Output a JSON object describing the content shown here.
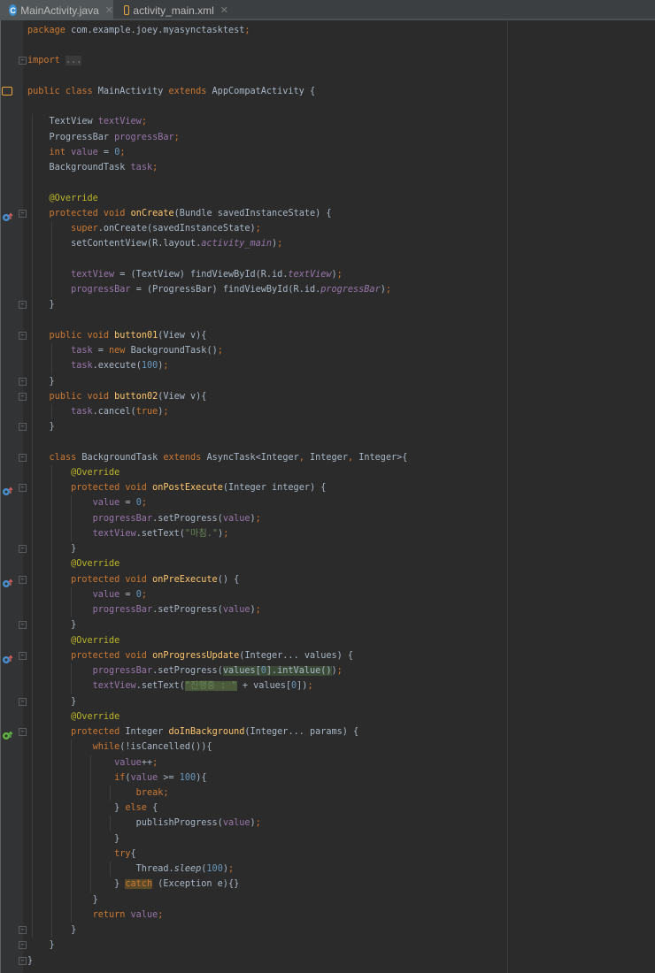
{
  "tabs": [
    {
      "label": "MainActivity.java",
      "icon": "C",
      "active": true
    },
    {
      "label": "activity_main.xml",
      "icon": "xml",
      "active": false
    }
  ],
  "colors": {
    "keyword": "#cc7832",
    "plain": "#a9b7c6",
    "field": "#9876aa",
    "number": "#6897bb",
    "string": "#6a8759",
    "annotation": "#bbb529",
    "method": "#ffc66d",
    "comment": "#808080"
  },
  "code": [
    {
      "line": 1,
      "tokens": [
        [
          "package ",
          "k"
        ],
        [
          "com.example.joey.myasynctasktest",
          "p"
        ],
        [
          ";",
          "k"
        ]
      ]
    },
    {
      "line": 3,
      "tokens": [
        [
          "import ",
          "k"
        ],
        [
          "...",
          "fold"
        ]
      ]
    },
    {
      "line": 5,
      "tokens": [
        [
          "public class ",
          "k"
        ],
        [
          "MainActivity ",
          "p"
        ],
        [
          "extends ",
          "k"
        ],
        [
          "AppCompatActivity {",
          "p"
        ]
      ]
    },
    {
      "line": 7,
      "tokens": [
        [
          "    TextView ",
          "p"
        ],
        [
          "textView",
          "f"
        ],
        [
          ";",
          "k"
        ]
      ]
    },
    {
      "line": 8,
      "tokens": [
        [
          "    ProgressBar ",
          "p"
        ],
        [
          "progressBar",
          "f"
        ],
        [
          ";",
          "k"
        ]
      ]
    },
    {
      "line": 9,
      "tokens": [
        [
          "    ",
          "p"
        ],
        [
          "int ",
          "k"
        ],
        [
          "value ",
          "f"
        ],
        [
          "= ",
          "p"
        ],
        [
          "0",
          "n"
        ],
        [
          ";",
          "k"
        ]
      ]
    },
    {
      "line": 10,
      "tokens": [
        [
          "    BackgroundTask ",
          "p"
        ],
        [
          "task",
          "f"
        ],
        [
          ";",
          "k"
        ]
      ]
    },
    {
      "line": 12,
      "tokens": [
        [
          "    @Override",
          "a"
        ]
      ]
    },
    {
      "line": 13,
      "tokens": [
        [
          "    ",
          "p"
        ],
        [
          "protected void ",
          "k"
        ],
        [
          "onCreate",
          "m"
        ],
        [
          "(Bundle savedInstanceState) {",
          "p"
        ]
      ]
    },
    {
      "line": 14,
      "tokens": [
        [
          "        ",
          "p"
        ],
        [
          "super",
          "k"
        ],
        [
          ".onCreate(savedInstanceState)",
          "p"
        ],
        [
          ";",
          "k"
        ]
      ]
    },
    {
      "line": 15,
      "tokens": [
        [
          "        setContentView(R.layout.",
          "p"
        ],
        [
          "activity_main",
          "fi"
        ],
        [
          ")",
          "p"
        ],
        [
          ";",
          "k"
        ]
      ]
    },
    {
      "line": 17,
      "tokens": [
        [
          "        ",
          "p"
        ],
        [
          "textView ",
          "f"
        ],
        [
          "= (TextView) findViewById(R.id.",
          "p"
        ],
        [
          "textView",
          "fi"
        ],
        [
          ")",
          "p"
        ],
        [
          ";",
          "k"
        ]
      ]
    },
    {
      "line": 18,
      "tokens": [
        [
          "        ",
          "p"
        ],
        [
          "progressBar ",
          "f"
        ],
        [
          "= (ProgressBar) findViewById(R.id.",
          "p"
        ],
        [
          "progressBar",
          "fi"
        ],
        [
          ")",
          "p"
        ],
        [
          ";",
          "k"
        ]
      ]
    },
    {
      "line": 19,
      "tokens": [
        [
          "    }",
          "p"
        ]
      ]
    },
    {
      "line": 21,
      "tokens": [
        [
          "    ",
          "p"
        ],
        [
          "public void ",
          "k"
        ],
        [
          "button01",
          "m"
        ],
        [
          "(View v){",
          "p"
        ]
      ]
    },
    {
      "line": 22,
      "tokens": [
        [
          "        ",
          "p"
        ],
        [
          "task ",
          "f"
        ],
        [
          "= ",
          "p"
        ],
        [
          "new ",
          "k"
        ],
        [
          "BackgroundTask()",
          "p"
        ],
        [
          ";",
          "k"
        ]
      ]
    },
    {
      "line": 23,
      "tokens": [
        [
          "        ",
          "p"
        ],
        [
          "task",
          "f"
        ],
        [
          ".execute(",
          "p"
        ],
        [
          "100",
          "n"
        ],
        [
          ")",
          "p"
        ],
        [
          ";",
          "k"
        ]
      ]
    },
    {
      "line": 24,
      "tokens": [
        [
          "    }",
          "p"
        ]
      ]
    },
    {
      "line": 25,
      "tokens": [
        [
          "    ",
          "p"
        ],
        [
          "public void ",
          "k"
        ],
        [
          "button02",
          "m"
        ],
        [
          "(View v){",
          "p"
        ]
      ]
    },
    {
      "line": 26,
      "tokens": [
        [
          "        ",
          "p"
        ],
        [
          "task",
          "f"
        ],
        [
          ".cancel(",
          "p"
        ],
        [
          "true",
          "k"
        ],
        [
          ")",
          "p"
        ],
        [
          ";",
          "k"
        ]
      ]
    },
    {
      "line": 27,
      "tokens": [
        [
          "    }",
          "p"
        ]
      ]
    },
    {
      "line": 29,
      "tokens": [
        [
          "    ",
          "p"
        ],
        [
          "class ",
          "k"
        ],
        [
          "BackgroundTask ",
          "p"
        ],
        [
          "extends ",
          "k"
        ],
        [
          "AsyncTask<Integer",
          "p"
        ],
        [
          ", ",
          "k"
        ],
        [
          "Integer",
          "p"
        ],
        [
          ", ",
          "k"
        ],
        [
          "Integer>{",
          "p"
        ]
      ]
    },
    {
      "line": 30,
      "tokens": [
        [
          "        @Override",
          "a"
        ]
      ]
    },
    {
      "line": 31,
      "tokens": [
        [
          "        ",
          "p"
        ],
        [
          "protected void ",
          "k"
        ],
        [
          "onPostExecute",
          "m"
        ],
        [
          "(Integer integer) {",
          "p"
        ]
      ]
    },
    {
      "line": 32,
      "tokens": [
        [
          "            ",
          "p"
        ],
        [
          "value ",
          "f"
        ],
        [
          "= ",
          "p"
        ],
        [
          "0",
          "n"
        ],
        [
          ";",
          "k"
        ]
      ]
    },
    {
      "line": 33,
      "tokens": [
        [
          "            ",
          "p"
        ],
        [
          "progressBar",
          "f"
        ],
        [
          ".setProgress(",
          "p"
        ],
        [
          "value",
          "f"
        ],
        [
          ")",
          "p"
        ],
        [
          ";",
          "k"
        ]
      ]
    },
    {
      "line": 34,
      "tokens": [
        [
          "            ",
          "p"
        ],
        [
          "textView",
          "f"
        ],
        [
          ".setText(",
          "p"
        ],
        [
          "\"마침.\"",
          "s"
        ],
        [
          ")",
          "p"
        ],
        [
          ";",
          "k"
        ]
      ]
    },
    {
      "line": 35,
      "tokens": [
        [
          "        }",
          "p"
        ]
      ]
    },
    {
      "line": 36,
      "tokens": [
        [
          "        @Override",
          "a"
        ]
      ]
    },
    {
      "line": 37,
      "tokens": [
        [
          "        ",
          "p"
        ],
        [
          "protected void ",
          "k"
        ],
        [
          "onPreExecute",
          "m"
        ],
        [
          "() {",
          "p"
        ]
      ]
    },
    {
      "line": 38,
      "tokens": [
        [
          "            ",
          "p"
        ],
        [
          "value ",
          "f"
        ],
        [
          "= ",
          "p"
        ],
        [
          "0",
          "n"
        ],
        [
          ";",
          "k"
        ]
      ]
    },
    {
      "line": 39,
      "tokens": [
        [
          "            ",
          "p"
        ],
        [
          "progressBar",
          "f"
        ],
        [
          ".setProgress(",
          "p"
        ],
        [
          "value",
          "f"
        ],
        [
          ")",
          "p"
        ],
        [
          ";",
          "k"
        ]
      ]
    },
    {
      "line": 40,
      "tokens": [
        [
          "        }",
          "p"
        ]
      ]
    },
    {
      "line": 41,
      "tokens": [
        [
          "        @Override",
          "a"
        ]
      ]
    },
    {
      "line": 42,
      "tokens": [
        [
          "        ",
          "p"
        ],
        [
          "protected void ",
          "k"
        ],
        [
          "onProgressUpdate",
          "m"
        ],
        [
          "(Integer... values) {",
          "p"
        ]
      ]
    },
    {
      "line": 43,
      "tokens": [
        [
          "            ",
          "p"
        ],
        [
          "progressBar",
          "f"
        ],
        [
          ".setProgress(",
          "p"
        ],
        [
          "values[",
          "ph"
        ],
        [
          "0",
          "nh"
        ],
        [
          "].intValue()",
          "ph"
        ],
        [
          ")",
          "p"
        ],
        [
          ";",
          "k"
        ]
      ]
    },
    {
      "line": 44,
      "tokens": [
        [
          "            ",
          "p"
        ],
        [
          "textView",
          "f"
        ],
        [
          ".setText(",
          "p"
        ],
        [
          "\"진행중 : \"",
          "sh"
        ],
        [
          " + values[",
          "p"
        ],
        [
          "0",
          "n"
        ],
        [
          "])",
          "p"
        ],
        [
          ";",
          "k"
        ]
      ]
    },
    {
      "line": 45,
      "tokens": [
        [
          "        }",
          "p"
        ]
      ]
    },
    {
      "line": 46,
      "tokens": [
        [
          "        @Override",
          "a"
        ]
      ]
    },
    {
      "line": 47,
      "tokens": [
        [
          "        ",
          "p"
        ],
        [
          "protected ",
          "k"
        ],
        [
          "Integer ",
          "p"
        ],
        [
          "doInBackground",
          "m"
        ],
        [
          "(Integer... params) {",
          "p"
        ]
      ]
    },
    {
      "line": 48,
      "tokens": [
        [
          "            ",
          "p"
        ],
        [
          "while",
          "k"
        ],
        [
          "(!isCancelled()){",
          "p"
        ]
      ]
    },
    {
      "line": 49,
      "tokens": [
        [
          "                ",
          "p"
        ],
        [
          "value",
          "f"
        ],
        [
          "++",
          "p"
        ],
        [
          ";",
          "k"
        ]
      ]
    },
    {
      "line": 50,
      "tokens": [
        [
          "                ",
          "p"
        ],
        [
          "if",
          "k"
        ],
        [
          "(",
          "p"
        ],
        [
          "value ",
          "f"
        ],
        [
          ">= ",
          "p"
        ],
        [
          "100",
          "n"
        ],
        [
          "){",
          "p"
        ]
      ]
    },
    {
      "line": 51,
      "tokens": [
        [
          "                    ",
          "p"
        ],
        [
          "break;",
          "k"
        ]
      ]
    },
    {
      "line": 52,
      "tokens": [
        [
          "                } ",
          "p"
        ],
        [
          "else ",
          "k"
        ],
        [
          "{",
          "p"
        ]
      ]
    },
    {
      "line": 53,
      "tokens": [
        [
          "                    publishProgress(",
          "p"
        ],
        [
          "value",
          "f"
        ],
        [
          ")",
          "p"
        ],
        [
          ";",
          "k"
        ]
      ]
    },
    {
      "line": 54,
      "tokens": [
        [
          "                }",
          "p"
        ]
      ]
    },
    {
      "line": 55,
      "tokens": [
        [
          "                ",
          "p"
        ],
        [
          "try",
          "k"
        ],
        [
          "{",
          "p"
        ]
      ]
    },
    {
      "line": 56,
      "tokens": [
        [
          "                    Thread.",
          "p"
        ],
        [
          "sleep",
          "mi"
        ],
        [
          "(",
          "p"
        ],
        [
          "100",
          "n"
        ],
        [
          ")",
          "p"
        ],
        [
          ";",
          "k"
        ]
      ]
    },
    {
      "line": 57,
      "tokens": [
        [
          "                } ",
          "p"
        ],
        [
          "catch",
          "kh"
        ],
        [
          " (Exception e){}",
          "p"
        ]
      ]
    },
    {
      "line": 58,
      "tokens": [
        [
          "            }",
          "p"
        ]
      ]
    },
    {
      "line": 59,
      "tokens": [
        [
          "            ",
          "p"
        ],
        [
          "return ",
          "k"
        ],
        [
          "value",
          "f"
        ],
        [
          ";",
          "k"
        ]
      ]
    },
    {
      "line": 60,
      "tokens": [
        [
          "        }",
          "p"
        ]
      ]
    },
    {
      "line": 61,
      "tokens": [
        [
          "    }",
          "p"
        ]
      ]
    },
    {
      "line": 62,
      "tokens": [
        [
          "}",
          "p"
        ]
      ]
    }
  ],
  "gutter": {
    "folds": [
      3,
      13,
      19,
      21,
      24,
      25,
      27,
      29,
      31,
      35,
      37,
      40,
      42,
      45,
      47,
      60,
      61,
      62
    ],
    "override_icons": [
      {
        "line": 13,
        "icon": "override-up-icon",
        "color": "#4a8fd0"
      },
      {
        "line": 31,
        "icon": "override-up-icon",
        "color": "#4a8fd0"
      },
      {
        "line": 37,
        "icon": "override-up-icon",
        "color": "#4a8fd0"
      },
      {
        "line": 42,
        "icon": "override-up-icon",
        "color": "#4a8fd0"
      },
      {
        "line": 47,
        "icon": "implement-up-icon",
        "color": "#62b543"
      }
    ],
    "class_icon_line": 5
  }
}
